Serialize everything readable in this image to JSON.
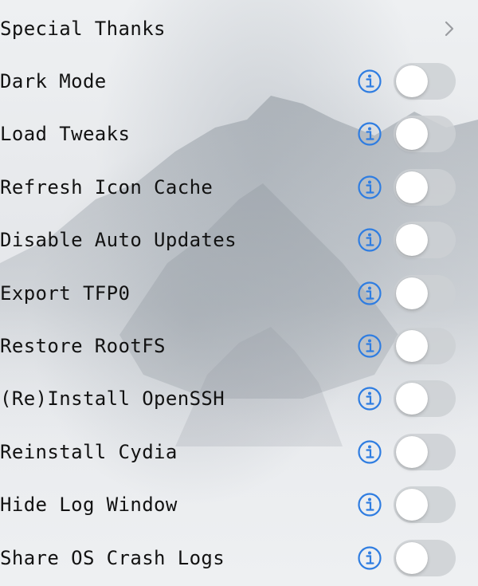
{
  "settings": {
    "special_thanks": {
      "label": "Special Thanks",
      "icon": "chevron-right-icon"
    },
    "items": [
      {
        "label": "Dark Mode",
        "enabled": false
      },
      {
        "label": "Load Tweaks",
        "enabled": false
      },
      {
        "label": "Refresh Icon Cache",
        "enabled": false
      },
      {
        "label": "Disable Auto Updates",
        "enabled": false
      },
      {
        "label": "Export TFP0",
        "enabled": false
      },
      {
        "label": "Restore RootFS",
        "enabled": false
      },
      {
        "label": "(Re)Install OpenSSH",
        "enabled": false
      },
      {
        "label": "Reinstall Cydia",
        "enabled": false
      },
      {
        "label": "Hide Log Window",
        "enabled": false
      },
      {
        "label": "Share OS Crash Logs",
        "enabled": false
      }
    ]
  },
  "colors": {
    "accent": "#2f7de1",
    "toggle_off": "#cdd0d4",
    "text": "#121212",
    "chevron": "#9a9ca0"
  }
}
